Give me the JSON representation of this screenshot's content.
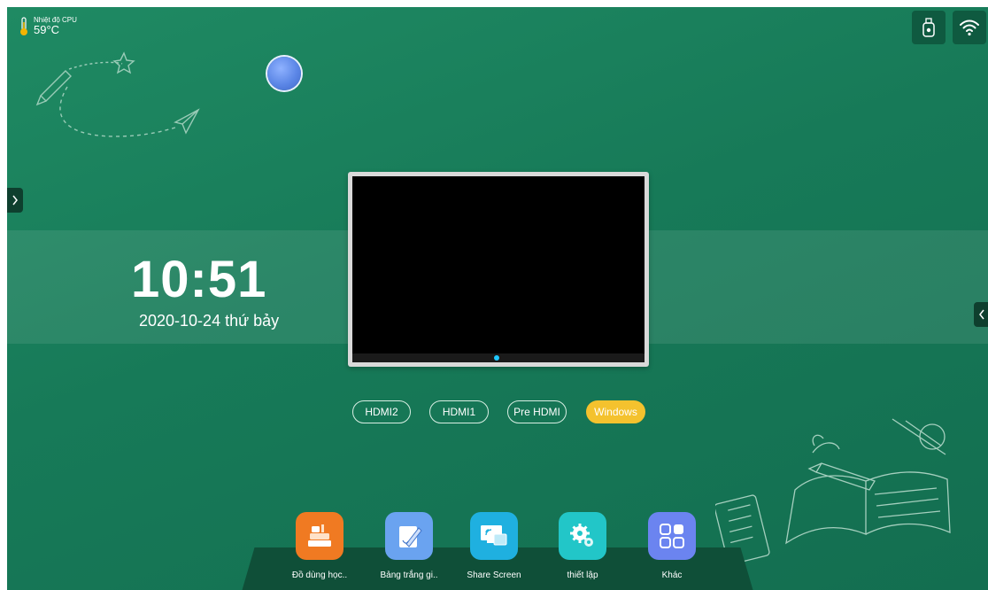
{
  "status": {
    "cpu_label": "Nhiệt độ CPU",
    "cpu_value": "59°C",
    "icons": [
      "thermometer-icon",
      "usb-drive-icon",
      "wifi-icon"
    ]
  },
  "clock": {
    "time": "10:51",
    "date": "2020-10-24 thứ bảy"
  },
  "sources": [
    {
      "label": "HDMI2",
      "active": false
    },
    {
      "label": "HDMI1",
      "active": false
    },
    {
      "label": "Pre HDMI",
      "active": false
    },
    {
      "label": "Windows",
      "active": true
    }
  ],
  "apps": [
    {
      "label": "Đồ dùng học..",
      "icon": "books-icon",
      "color": "#f07a22"
    },
    {
      "label": "Bảng trắng gi..",
      "icon": "whiteboard-pen-icon",
      "color": "#6aa3f0"
    },
    {
      "label": "Share Screen",
      "icon": "share-screen-icon",
      "color": "#1fb0e0"
    },
    {
      "label": "thiết lập",
      "icon": "settings-gears-icon",
      "color": "#22c6c8"
    },
    {
      "label": "Khác",
      "icon": "apps-grid-icon",
      "color": "#6b84f0"
    }
  ],
  "colors": {
    "background": "#177a58",
    "active_source": "#f4c22e",
    "dock": "#0f4f38"
  }
}
